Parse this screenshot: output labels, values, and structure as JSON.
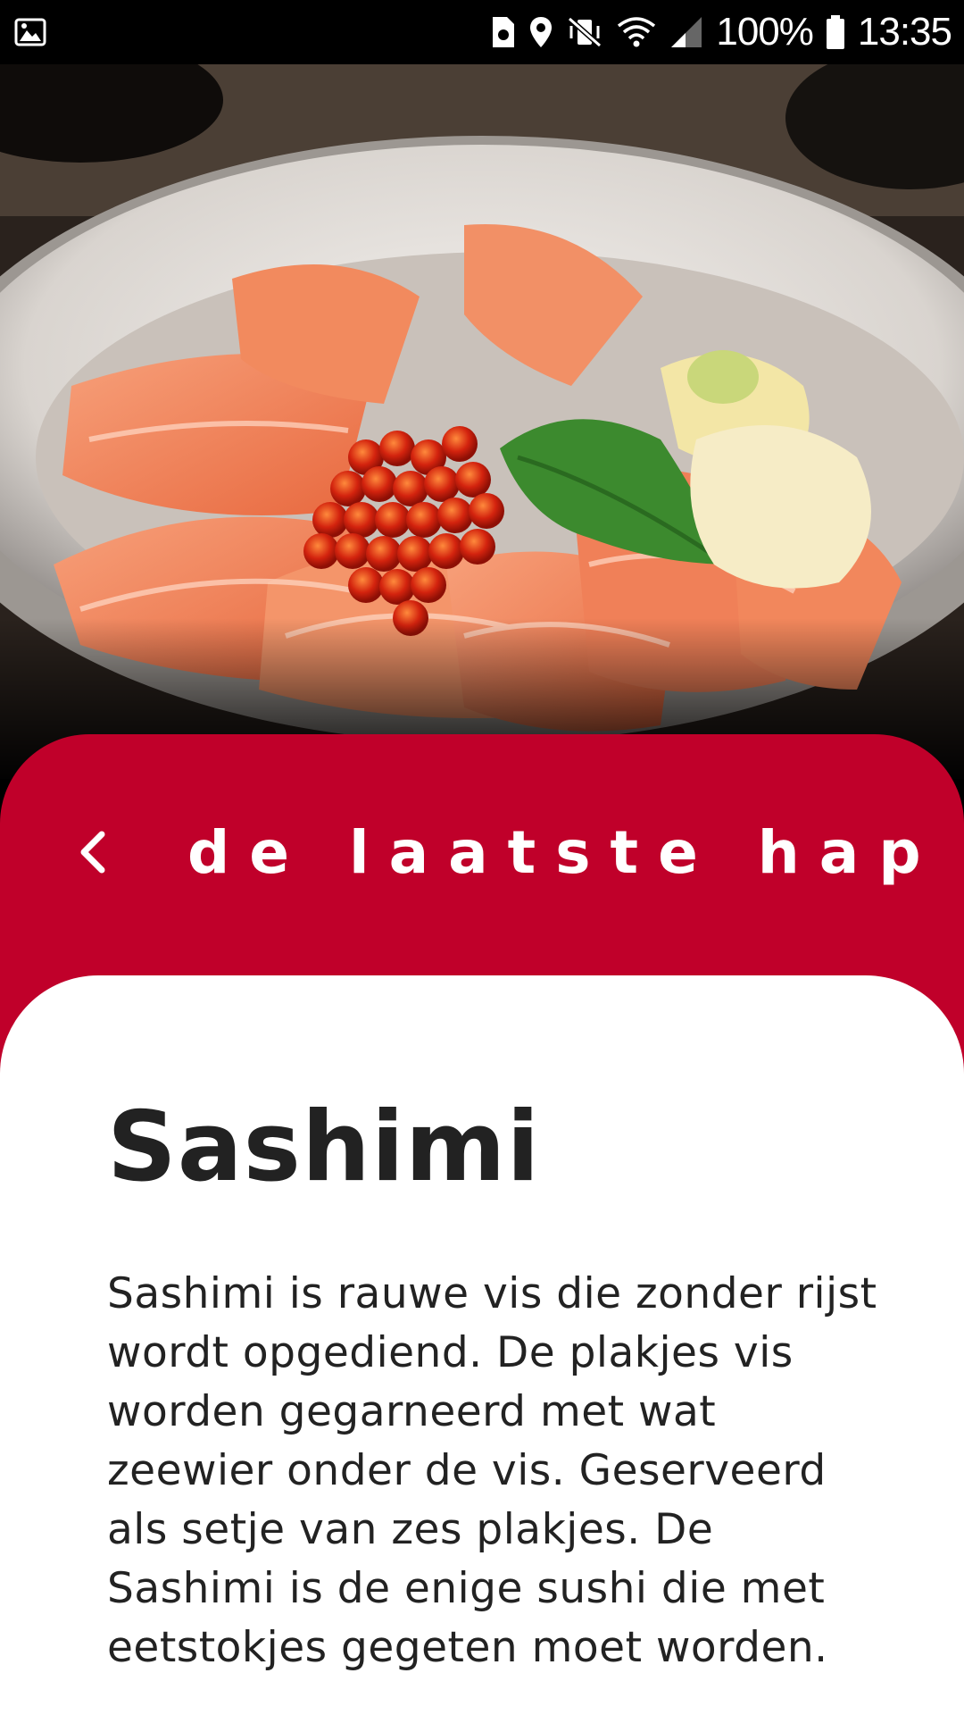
{
  "status_bar": {
    "battery": "100%",
    "time": "13:35",
    "icons": [
      "image-icon",
      "sim-icon",
      "location-icon",
      "vibrate-mute-icon",
      "wifi-icon",
      "signal-icon",
      "battery-icon"
    ]
  },
  "hero": {
    "image": "salmon sashimi bowl with roe, shiso leaf and ginger"
  },
  "header": {
    "brand": "de laatste hap",
    "back_icon": "chevron-left-icon"
  },
  "dish": {
    "title": "Sashimi",
    "description": "Sashimi is rauwe vis die zonder rijst wordt opgediend. De plakjes vis worden gegarneerd met wat zeewier onder de vis. Geserveerd als setje van zes plakjes. De Sashimi is de enige sushi die met eetstokjes gegeten moet worden."
  },
  "colors": {
    "accent": "#c0002a",
    "text": "#222222",
    "card": "#ffffff"
  }
}
